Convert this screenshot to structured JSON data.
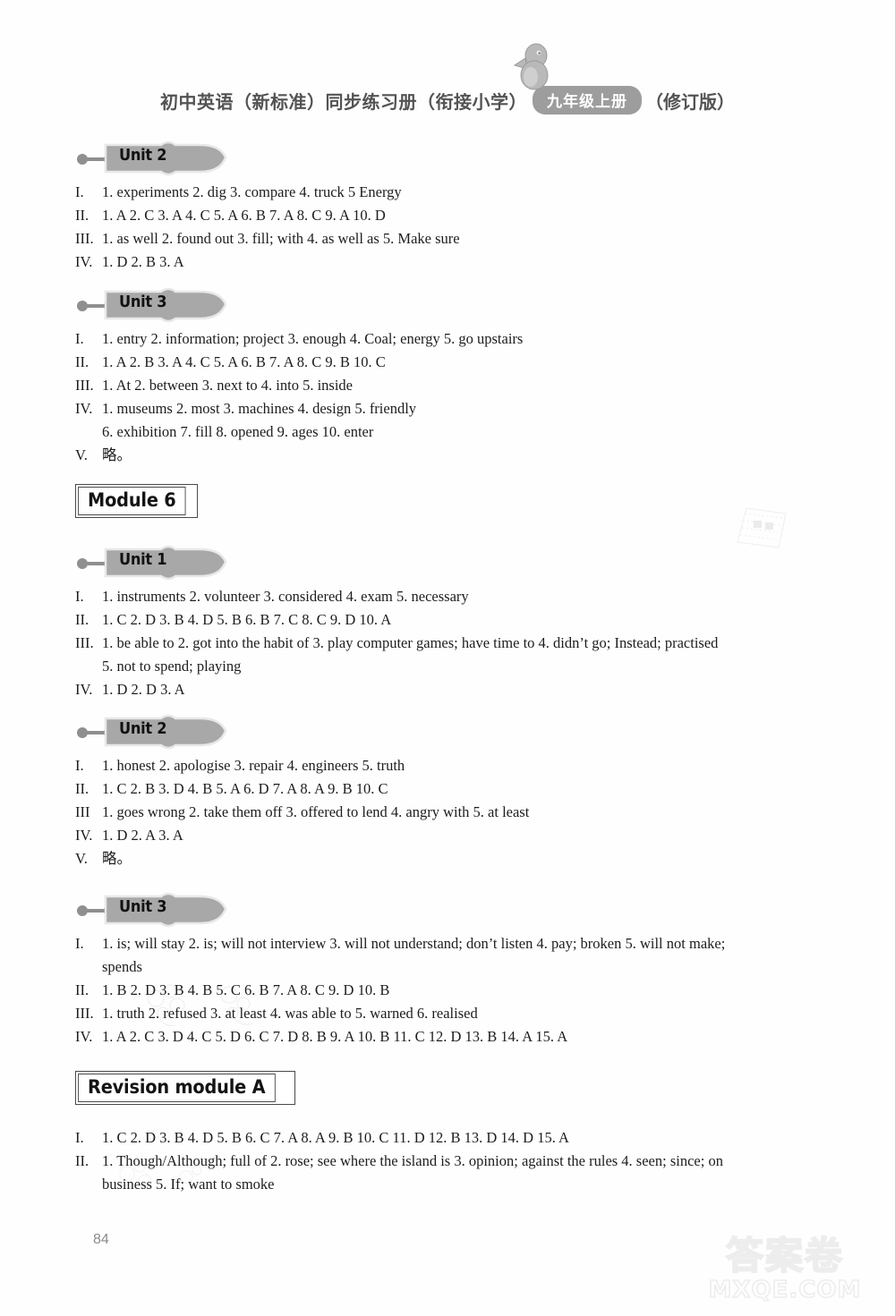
{
  "header": {
    "title": "初中英语（新标准）同步练习册（衔接小学）",
    "grade_badge": "九年级上册",
    "suffix": "（修订版）",
    "mascot_icon": "bird-mascot-icon"
  },
  "sections": [
    {
      "id": "unit2-top",
      "type": "unit",
      "label": "Unit 2",
      "lines": [
        {
          "num": "I.",
          "text": "1. experiments   2. dig   3. compare   4. truck   5 Energy"
        },
        {
          "num": "II.",
          "text": "1. A   2. C   3. A   4. C   5. A   6. B   7. A   8. C   9. A   10. D"
        },
        {
          "num": "III.",
          "text": "1. as well   2. found out   3. fill; with   4. as well as   5. Make sure"
        },
        {
          "num": "IV.",
          "text": "1. D   2. B   3. A"
        }
      ]
    },
    {
      "id": "unit3-top",
      "type": "unit",
      "label": "Unit 3",
      "lines": [
        {
          "num": "I.",
          "text": "1. entry   2. information; project   3. enough   4. Coal; energy   5. go upstairs"
        },
        {
          "num": "II.",
          "text": "1. A   2. B   3. A   4. C   5. A   6. B   7. A   8. C   9. B   10. C"
        },
        {
          "num": "III.",
          "text": "1. At   2. between   3. next to   4. into   5. inside"
        },
        {
          "num": "IV.",
          "text": "1. museums   2. most   3. machines   4. design   5. friendly",
          "cont": "6. exhibition   7. fill   8. opened   9. ages   10. enter"
        },
        {
          "num": "V.",
          "text": "略。"
        }
      ]
    },
    {
      "id": "module6",
      "type": "module",
      "label": "Module 6"
    },
    {
      "id": "unit1",
      "type": "unit",
      "label": "Unit 1",
      "lines": [
        {
          "num": "I.",
          "text": "1. instruments   2. volunteer   3. considered   4. exam   5. necessary"
        },
        {
          "num": "II.",
          "text": "1. C   2. D   3. B   4. D   5. B   6. B   7. C   8. C   9. D   10. A"
        },
        {
          "num": "III.",
          "text": "1. be able to   2. got into the habit of   3. play computer games; have time to   4. didn’t go; Instead; practised",
          "cont": "5. not to spend; playing"
        },
        {
          "num": "IV.",
          "text": "1. D   2. D   3. A"
        }
      ]
    },
    {
      "id": "unit2-mid",
      "type": "unit",
      "label": "Unit 2",
      "lines": [
        {
          "num": "I.",
          "text": "1. honest   2. apologise   3. repair   4. engineers   5. truth"
        },
        {
          "num": "II.",
          "text": "1. C   2. B   3. D   4. B   5. A   6. D   7. A   8. A   9. B   10. C"
        },
        {
          "num": "III",
          "text": "1. goes wrong   2. take them off   3. offered to lend   4. angry with   5. at least"
        },
        {
          "num": "IV.",
          "text": "1. D   2. A   3. A"
        },
        {
          "num": "V.",
          "text": "略。"
        }
      ]
    },
    {
      "id": "unit3-bottom",
      "type": "unit",
      "label": "Unit 3",
      "lines": [
        {
          "num": "I.",
          "text": "1. is; will stay   2. is; will not interview   3. will not understand; don’t listen   4. pay; broken   5. will not make;",
          "cont": "spends"
        },
        {
          "num": "II.",
          "text": "1. B   2. D   3. B   4. B   5. C   6. B   7. A   8. C   9. D   10. B"
        },
        {
          "num": "III.",
          "text": "1. truth   2. refused   3. at least   4. was able to   5. warned   6. realised"
        },
        {
          "num": "IV.",
          "text": "1. A   2. C   3. D   4. C   5. D   6. C   7. D   8. B   9. A   10. B   11. C   12. D   13. B   14. A   15. A"
        }
      ]
    },
    {
      "id": "revision-a",
      "type": "module",
      "label": "Revision module A"
    },
    {
      "id": "revision-a-answers",
      "type": "answers",
      "lines": [
        {
          "num": "I.",
          "text": "1. C   2. D   3. B   4. D   5. B   6. C   7. A   8. A   9. B   10. C   11. D   12. B   13. D   14. D   15. A"
        },
        {
          "num": "II.",
          "text": "1. Though/Although; full of   2. rose; see where the island is   3. opinion; against the rules   4. seen; since; on",
          "cont": "business   5. If; want to smoke"
        }
      ]
    }
  ],
  "footer": {
    "page_number": "84",
    "watermark_cn": "答案卷",
    "watermark_url": "MXQE.COM"
  },
  "colors": {
    "tag_fill": "#a8a8a8",
    "tag_stroke": "#ffffff",
    "badge_gray": "#9d9d9d",
    "text": "#1d1d1d"
  }
}
